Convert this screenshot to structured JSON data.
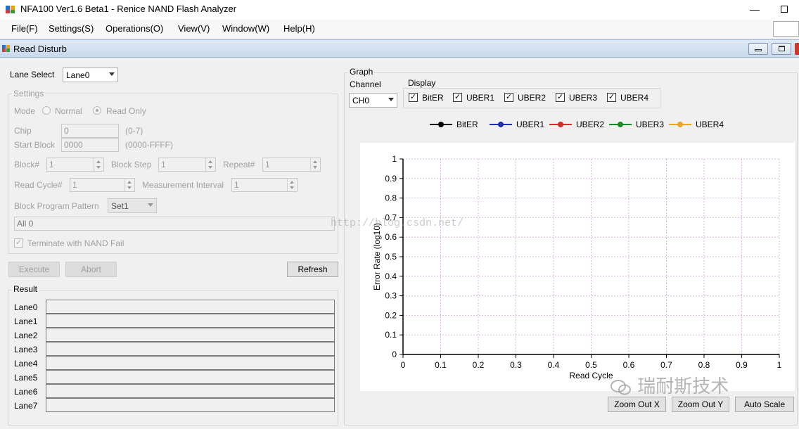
{
  "window": {
    "title": "NFA100 Ver1.6 Beta1 - Renice NAND Flash Analyzer",
    "minimize_glyph": "—"
  },
  "menu": [
    "File(F)",
    "Settings(S)",
    "Operations(O)",
    "View(V)",
    "Window(W)",
    "Help(H)"
  ],
  "child_window": {
    "title": "Read Disturb"
  },
  "lane_select": {
    "label": "Lane Select",
    "value": "Lane0"
  },
  "settings": {
    "title": "Settings",
    "mode_label": "Mode",
    "mode_normal": "Normal",
    "mode_read_only": "Read Only",
    "mode_selected": "Read Only",
    "chip_label": "Chip",
    "chip_value": "0",
    "chip_range": "(0-7)",
    "start_block_label": "Start Block",
    "start_block_value": "0000",
    "start_block_range": "(0000-FFFF)",
    "block_count_label": "Block#",
    "block_count_value": "1",
    "block_step_label": "Block Step",
    "block_step_value": "1",
    "repeat_label": "Repeat#",
    "repeat_value": "1",
    "read_cycle_label": "Read Cycle#",
    "read_cycle_value": "1",
    "measurement_interval_label": "Measurement Interval",
    "measurement_interval_value": "1",
    "pattern_label": "Block Program Pattern",
    "pattern_value": "Set1",
    "pattern_text": "All 0",
    "terminate_label": "Terminate with NAND Fail",
    "terminate_checked": true
  },
  "buttons": {
    "execute": "Execute",
    "abort": "Abort",
    "refresh": "Refresh"
  },
  "result": {
    "title": "Result",
    "lanes": [
      "Lane0",
      "Lane1",
      "Lane2",
      "Lane3",
      "Lane4",
      "Lane5",
      "Lane6",
      "Lane7"
    ]
  },
  "graph": {
    "title": "Graph",
    "channel_label": "Channel",
    "channel_value": "CH0",
    "display_title": "Display",
    "display_items": [
      {
        "label": "BitER",
        "checked": true
      },
      {
        "label": "UBER1",
        "checked": true
      },
      {
        "label": "UBER2",
        "checked": true
      },
      {
        "label": "UBER3",
        "checked": true
      },
      {
        "label": "UBER4",
        "checked": true
      }
    ],
    "zoom_out_x": "Zoom Out X",
    "zoom_out_y": "Zoom Out Y",
    "auto_scale": "Auto Scale"
  },
  "chart_data": {
    "type": "line",
    "xlabel": "Read Cycle",
    "ylabel": "Error Rate (log10)",
    "xlim": [
      0,
      1
    ],
    "ylim": [
      0,
      1
    ],
    "x_ticks": [
      "0",
      "0.1",
      "0.2",
      "0.3",
      "0.4",
      "0.5",
      "0.6",
      "0.7",
      "0.8",
      "0.9",
      "1"
    ],
    "y_ticks": [
      "0",
      "0.1",
      "0.2",
      "0.3",
      "0.4",
      "0.5",
      "0.6",
      "0.7",
      "0.8",
      "0.9",
      "1"
    ],
    "grid": true,
    "legend_position": "top",
    "series": [
      {
        "name": "BitER",
        "color": "#000000",
        "values": []
      },
      {
        "name": "UBER1",
        "color": "#1f2fa8",
        "values": []
      },
      {
        "name": "UBER2",
        "color": "#d42a2a",
        "values": []
      },
      {
        "name": "UBER3",
        "color": "#1d8a2a",
        "values": []
      },
      {
        "name": "UBER4",
        "color": "#e8a52c",
        "values": []
      }
    ]
  },
  "watermark": {
    "url_text": "http://blog.csdn.net/",
    "brand_text": "瑞耐斯技术"
  }
}
